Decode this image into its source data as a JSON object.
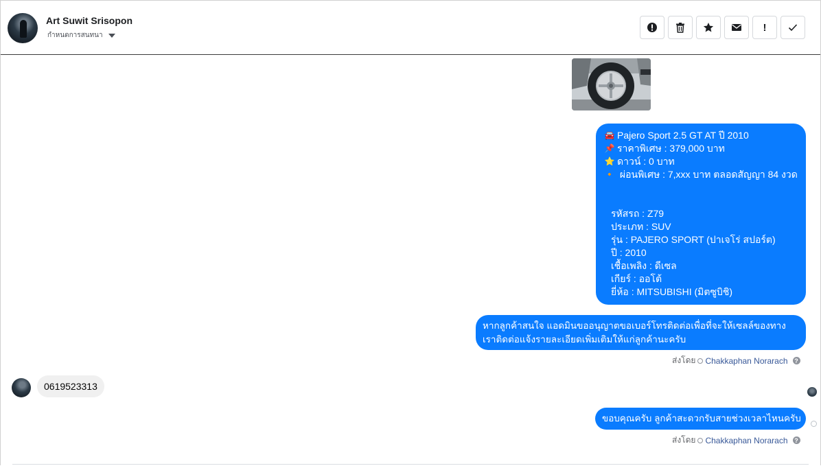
{
  "header": {
    "contact_name": "Art Suwit Srisopon",
    "sub_label": "กำหนดการสนทนา",
    "toolbar": [
      {
        "icon": "alert-circle-icon",
        "label": ""
      },
      {
        "icon": "trash-icon",
        "label": ""
      },
      {
        "icon": "star-icon",
        "label": ""
      },
      {
        "icon": "envelope-icon",
        "label": ""
      },
      {
        "icon": "exclamation-icon",
        "label": "!"
      },
      {
        "icon": "check-icon",
        "label": ""
      }
    ]
  },
  "messages": {
    "car_details": {
      "lines": [
        {
          "emoji": "🚘",
          "text": "Pajero Sport 2.5 GT AT ปี 2010"
        },
        {
          "emoji": "📌",
          "text": "ราคาพิเศษ : 379,000 บาท"
        },
        {
          "emoji": "⭐",
          "text": "ดาวน์ : 0 บาท"
        },
        {
          "emoji": "🔸",
          "text": " ผ่อนพิเศษ : 7,xxx บาท ตลอดสัญญา 84 งวด"
        }
      ],
      "specs": [
        "รหัสรถ : Z79",
        "ประเภท : SUV",
        "รุ่น : PAJERO SPORT (ปาเจโร่ สปอร์ต)",
        "ปี : 2010",
        "เชื้อเพลิง : ดีเซล",
        "เกียร์ : ออโต้",
        "ยี่ห้อ : MITSUBISHI (มิตซูบิชิ)"
      ]
    },
    "contact_request": "หากลูกค้าสนใจ แอดมินขออนุญาตขอเบอร์โทรติดต่อเพื่อที่จะให้เซลล์ของทางเราติดต่อแจ้งรายละเอียดเพิ่มเติมให้แก่ลูกค้านะครับ",
    "sent_by_label": "ส่งโดย",
    "sent_by_name": "Chakkaphan Norarach",
    "received_phone": "0619523313",
    "thanks": "ขอบคุณครับ ลูกค้าสะดวกรับสายช่วงเวลาไหนครับ"
  },
  "colors": {
    "bubble_blue": "#0a7cff",
    "received_bubble": "#f0f0f0",
    "sender_link": "#385898"
  }
}
